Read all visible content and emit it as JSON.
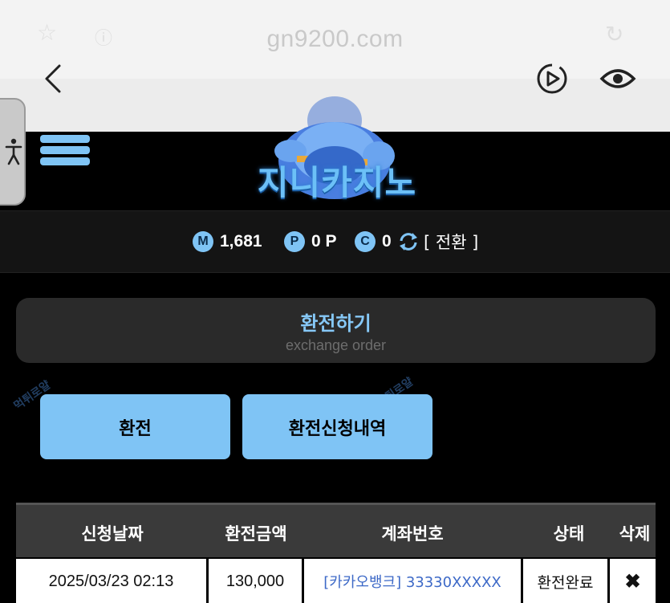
{
  "browser": {
    "url": "gn9200.com",
    "back_icon": "chevron-left-icon",
    "play_icon": "video-play-icon",
    "eye_icon": "eye-icon"
  },
  "site": {
    "logo_text": "지니카지노",
    "menu_icon": "hamburger-menu-icon"
  },
  "balances": {
    "money_badge": "M",
    "money_value": "1,681",
    "point_badge": "P",
    "point_value": "0 P",
    "casino_badge": "C",
    "casino_value": "0",
    "convert_label": "[ 전환 ]"
  },
  "panel": {
    "title": "환전하기",
    "subtitle": "exchange order"
  },
  "buttons": {
    "exchange": "환전",
    "history": "환전신청내역"
  },
  "watermark": "먹튀로얄",
  "table": {
    "headers": [
      "신청날짜",
      "환전금액",
      "계좌번호",
      "상태",
      "삭제"
    ],
    "rows": [
      {
        "date": "2025/03/23 02:13",
        "amount": "130,000",
        "account": "[카카오뱅크] 33330XXXXX",
        "status": "환전완료",
        "delete": "✖"
      }
    ]
  },
  "colors": {
    "accent": "#7fc4f5",
    "panel_bg": "#2a2a2a",
    "account_link": "#3d69c7"
  }
}
